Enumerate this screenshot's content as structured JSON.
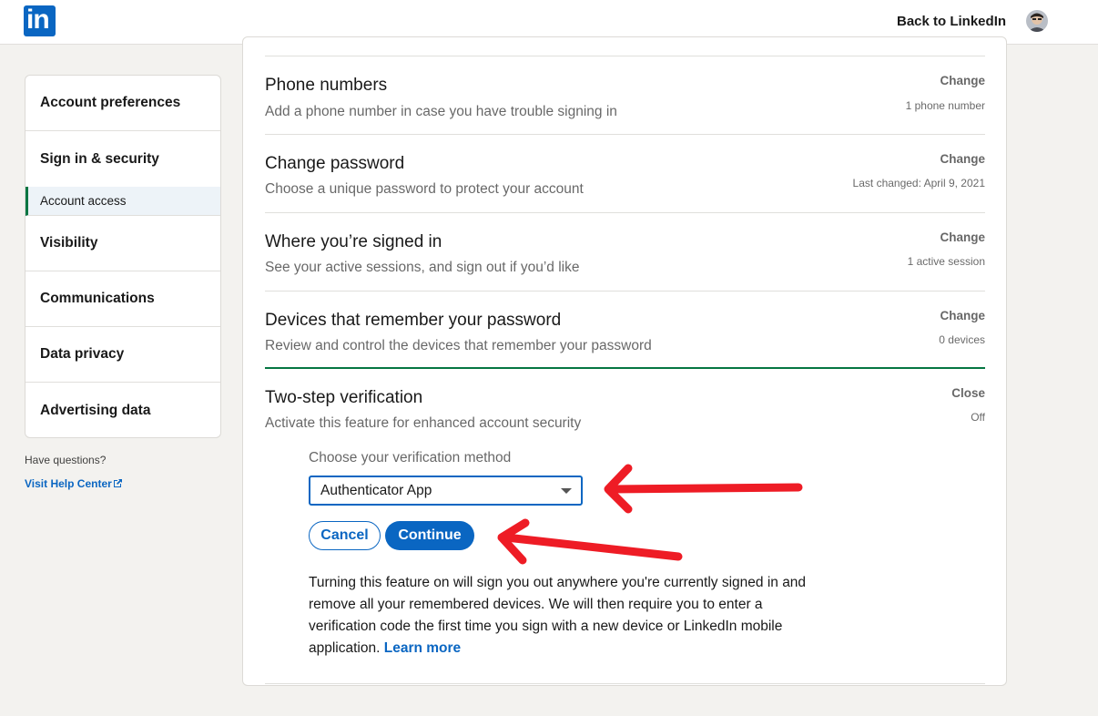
{
  "header": {
    "logo_text": "in",
    "back_link": "Back to LinkedIn"
  },
  "sidebar": {
    "items": [
      {
        "label": "Account preferences"
      },
      {
        "label": "Sign in & security"
      },
      {
        "label": "Account access"
      },
      {
        "label": "Visibility"
      },
      {
        "label": "Communications"
      },
      {
        "label": "Data privacy"
      },
      {
        "label": "Advertising data"
      }
    ],
    "questions": "Have questions?",
    "help_link": "Visit Help Center"
  },
  "settings": [
    {
      "title": "Phone numbers",
      "desc": "Add a phone number in case you have trouble signing in",
      "action": "Change",
      "status": "1 phone number"
    },
    {
      "title": "Change password",
      "desc": "Choose a unique password to protect your account",
      "action": "Change",
      "status": "Last changed: April 9, 2021"
    },
    {
      "title": "Where you’re signed in",
      "desc": "See your active sessions, and sign out if you’d like",
      "action": "Change",
      "status": "1 active session"
    },
    {
      "title": "Devices that remember your password",
      "desc": "Review and control the devices that remember your password",
      "action": "Change",
      "status": "0 devices"
    },
    {
      "title": "Two-step verification",
      "desc": "Activate this feature for enhanced account security",
      "action": "Close",
      "status": "Off"
    }
  ],
  "two_step": {
    "method_label": "Choose your verification method",
    "selected_method": "Authenticator App",
    "cancel": "Cancel",
    "continue": "Continue",
    "warning": "Turning this feature on will sign you out anywhere you're currently signed in and remove all your remembered devices. We will then require you to enter a verification code the first time you sign with a new device or LinkedIn mobile application.",
    "learn_more": "Learn more"
  },
  "colors": {
    "brand": "#0a66c2",
    "active_accent": "#057642",
    "annotation_arrow": "#ee1c25"
  }
}
